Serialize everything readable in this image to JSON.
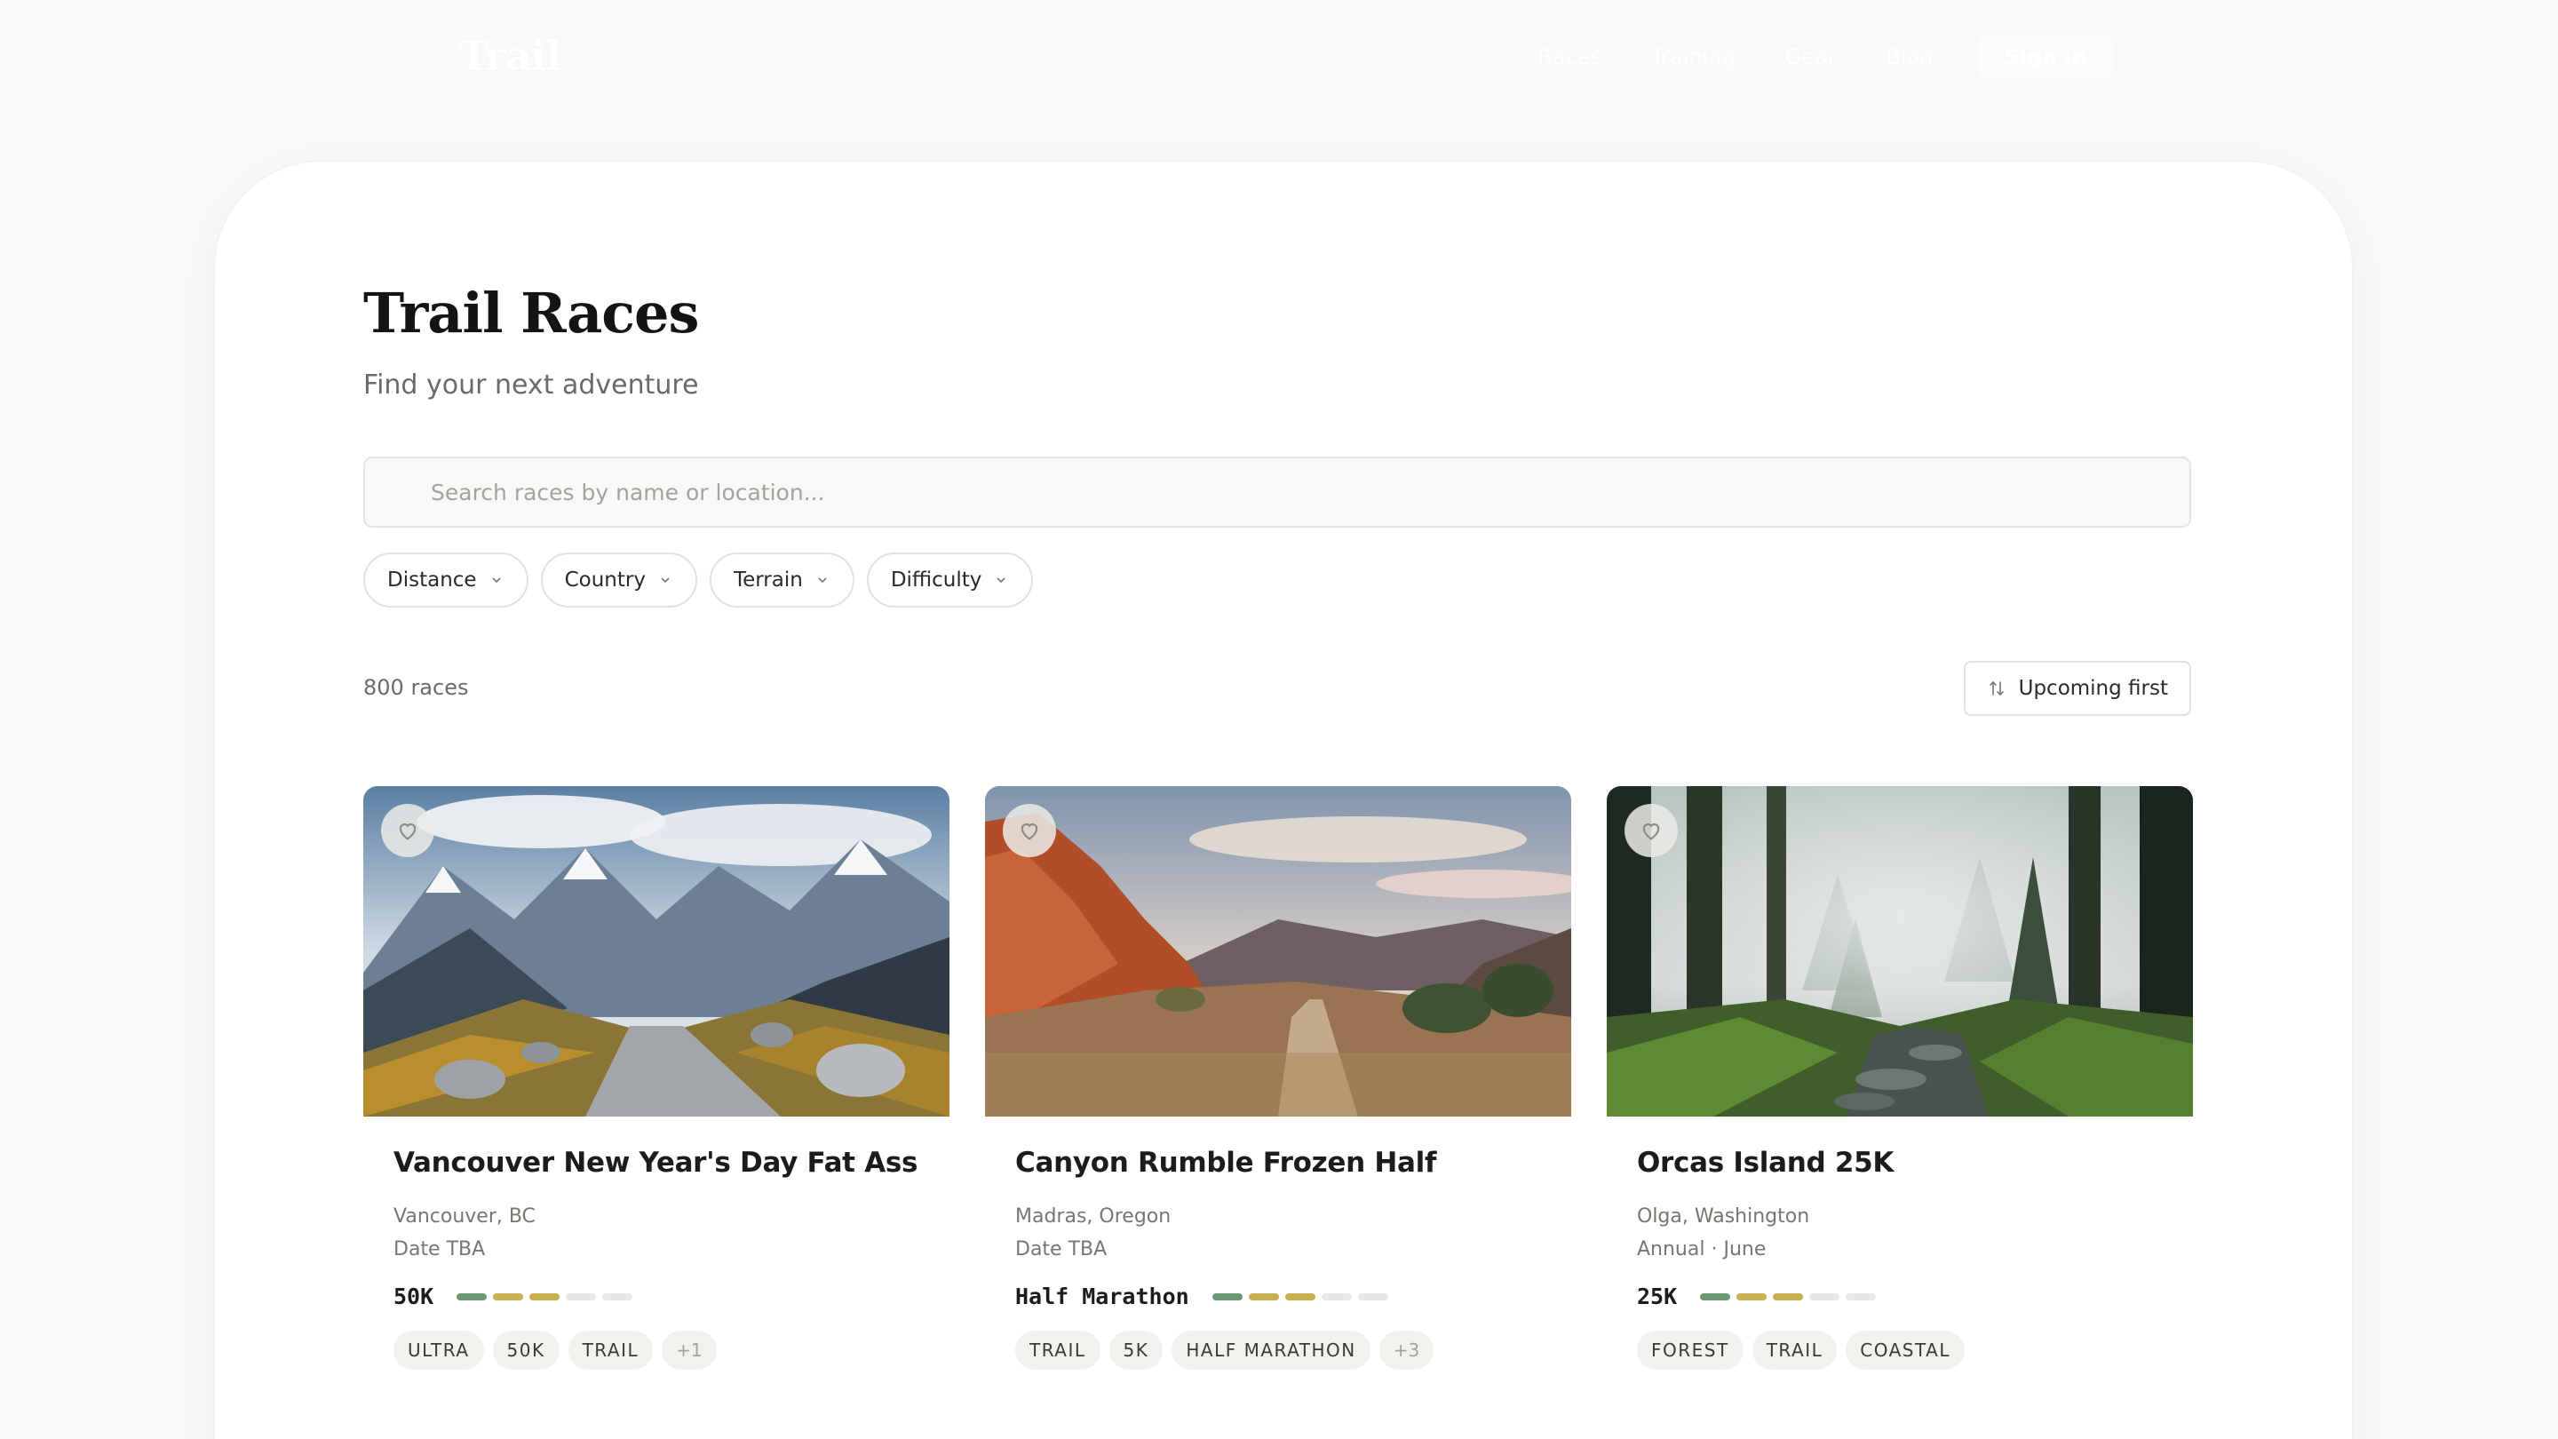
{
  "nav": {
    "brand": "Trail",
    "links": [
      "Races",
      "Training",
      "Gear",
      "Blog"
    ],
    "signin": "Sign in"
  },
  "page": {
    "title": "Trail Races",
    "subtitle": "Find your next adventure"
  },
  "search": {
    "placeholder": "Search races by name or location..."
  },
  "filters": [
    "Distance",
    "Country",
    "Terrain",
    "Difficulty"
  ],
  "results": {
    "count": "800 races",
    "sort_label": "Upcoming first"
  },
  "cards": [
    {
      "title": "Vancouver New Year's Day Fat Ass",
      "location": "Vancouver, BC",
      "date": "Date TBA",
      "distance": "50K",
      "difficulty": 3,
      "tags": [
        "ULTRA",
        "50K",
        "TRAIL",
        "+1"
      ],
      "image": "alpine-valley"
    },
    {
      "title": "Canyon Rumble Frozen Half",
      "location": "Madras, Oregon",
      "date": "Date TBA",
      "distance": "Half Marathon",
      "difficulty": 3,
      "tags": [
        "TRAIL",
        "5K",
        "HALF MARATHON",
        "+3"
      ],
      "image": "desert-canyon"
    },
    {
      "title": "Orcas Island 25K",
      "location": "Olga, Washington",
      "date": "Annual · June",
      "distance": "25K",
      "difficulty": 3,
      "tags": [
        "FOREST",
        "TRAIL",
        "COASTAL"
      ],
      "image": "misty-forest"
    }
  ],
  "colors": {
    "difficulty_easy": "#6a9a74",
    "difficulty_mid": "#c9b04f",
    "difficulty_off": "#e8e7e4"
  }
}
